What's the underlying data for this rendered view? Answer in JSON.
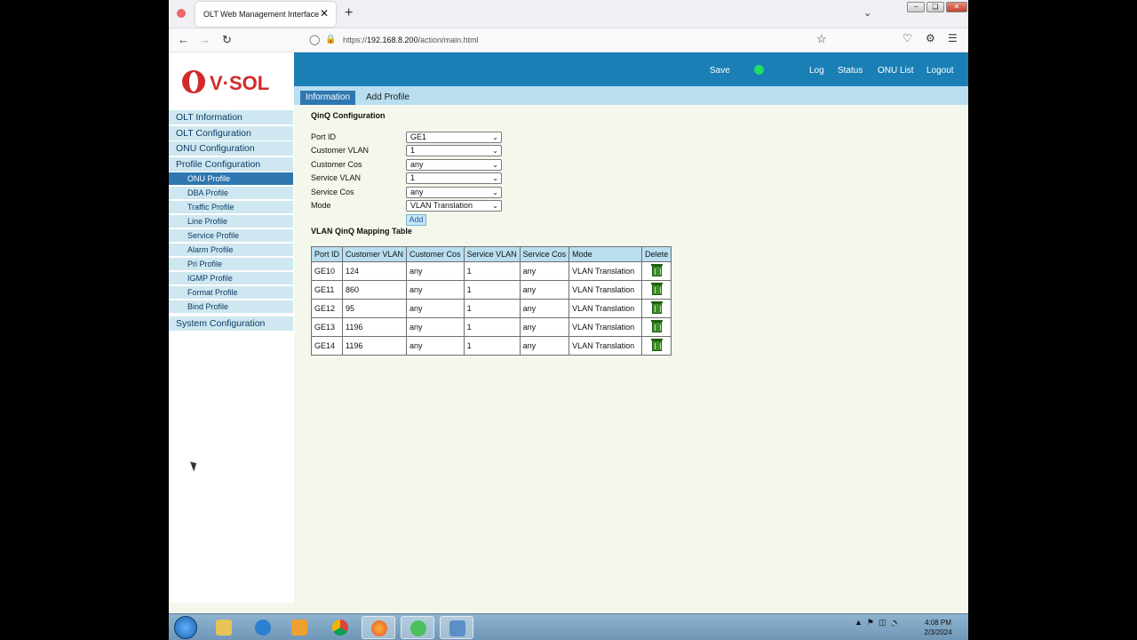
{
  "browser": {
    "tab_title": "OLT Web Management Interface",
    "tab_close": "✕",
    "new_tab": "+",
    "url_prefix": "https://",
    "url_host": "192.168.8.200",
    "url_path": "/action/main.html"
  },
  "logo": {
    "text": "V·SOL",
    "brand_color": "#d22a2a"
  },
  "topnav": {
    "save": "Save",
    "log": "Log",
    "status": "Status",
    "onu_list": "ONU List",
    "logout": "Logout",
    "status_led_color": "#22dd66"
  },
  "page_tabs": {
    "information": "Information",
    "add_profile": "Add Profile"
  },
  "sidebar": {
    "items": [
      "OLT Information",
      "OLT Configuration",
      "ONU Configuration",
      "Profile Configuration"
    ],
    "subitems": [
      "ONU Profile",
      "DBA Profile",
      "Traffic Profile",
      "Line Profile",
      "Service Profile",
      "Alarm Profile",
      "Pri Profile",
      "IGMP Profile",
      "Format Profile",
      "Bind Profile"
    ],
    "last_item": "System Configuration",
    "active_subitem": "ONU Profile"
  },
  "qinq": {
    "title": "QinQ Configuration",
    "fields": [
      {
        "label": "Port ID",
        "value": "GE1"
      },
      {
        "label": "Customer VLAN",
        "value": "1"
      },
      {
        "label": "Customer Cos",
        "value": "any"
      },
      {
        "label": "Service VLAN",
        "value": "1"
      },
      {
        "label": "Service Cos",
        "value": "any"
      },
      {
        "label": "Mode",
        "value": "VLAN Translation"
      }
    ],
    "add_label": "Add"
  },
  "mapping": {
    "title": "VLAN QinQ Mapping Table",
    "headers": [
      "Port ID",
      "Customer VLAN",
      "Customer Cos",
      "Service VLAN",
      "Service Cos",
      "Mode",
      "Delete"
    ],
    "rows": [
      [
        "GE10",
        "124",
        "any",
        "1",
        "any",
        "VLAN Translation"
      ],
      [
        "GE11",
        "860",
        "any",
        "1",
        "any",
        "VLAN Translation"
      ],
      [
        "GE12",
        "95",
        "any",
        "1",
        "any",
        "VLAN Translation"
      ],
      [
        "GE13",
        "1196",
        "any",
        "1",
        "any",
        "VLAN Translation"
      ],
      [
        "GE14",
        "1196",
        "any",
        "1",
        "any",
        "VLAN Translation"
      ]
    ]
  },
  "taskbar": {
    "time": "4:08 PM",
    "date": "2/3/2024"
  },
  "icons": {
    "start": "windows-start-icon",
    "explorer": "folder-icon",
    "ie": "internet-explorer-icon",
    "media": "media-player-icon",
    "chrome": "chrome-icon",
    "firefox": "firefox-icon",
    "clock_app": "alarm-clock-icon",
    "network": "network-icon"
  }
}
